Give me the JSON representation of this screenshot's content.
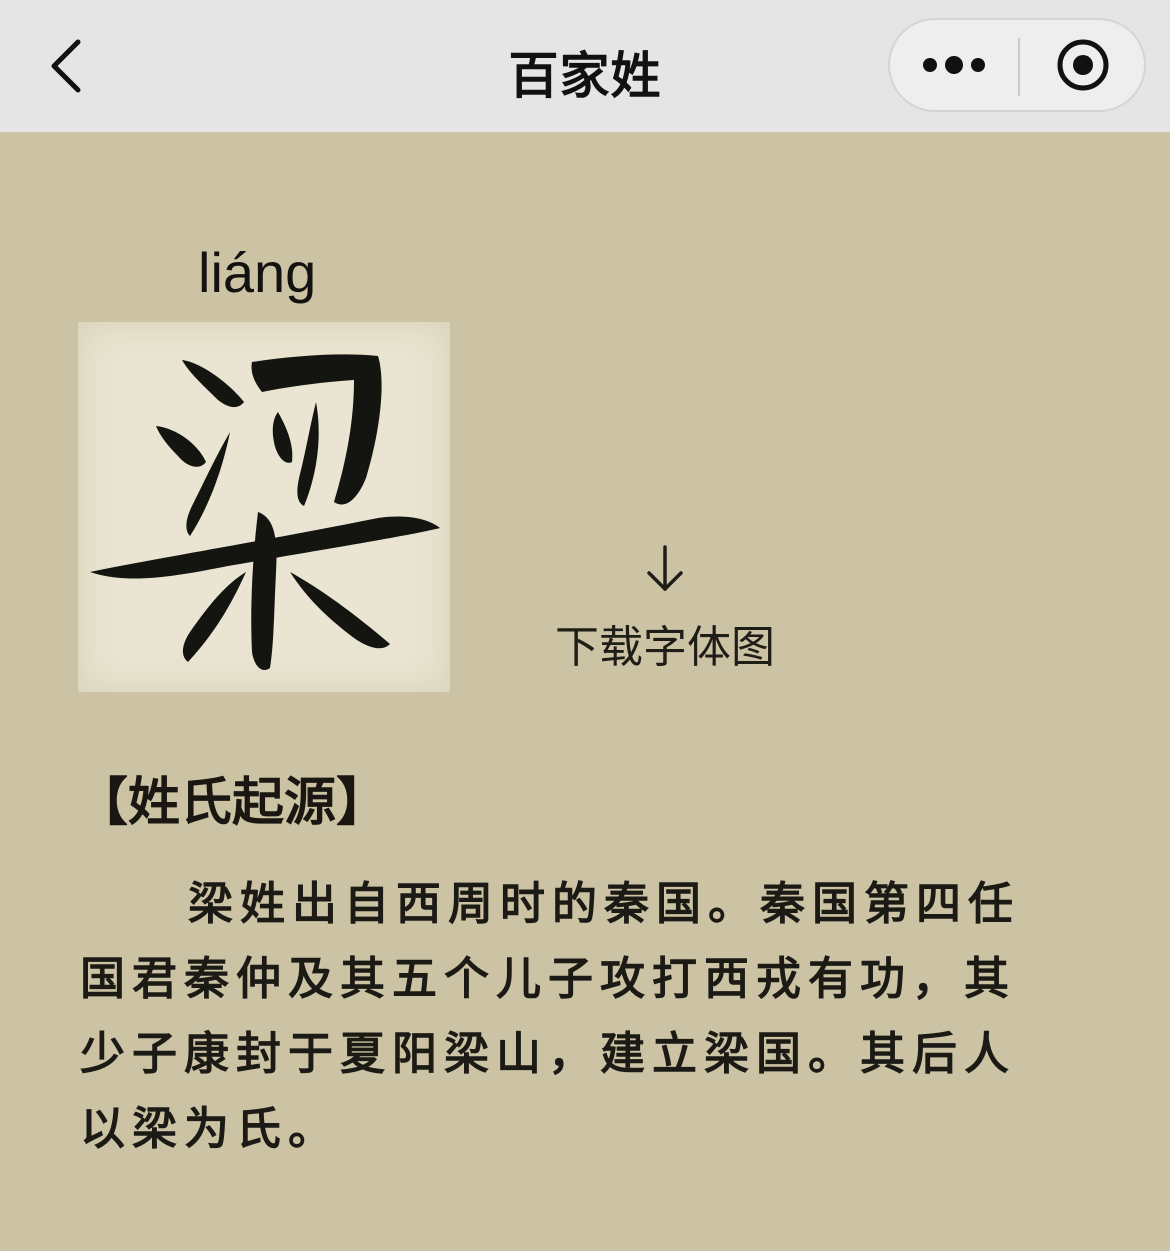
{
  "nav": {
    "title": "百家姓",
    "back_icon": "chevron-left-icon",
    "more_icon": "more-dots-icon",
    "close_icon": "target-close-icon"
  },
  "surname": {
    "pinyin": "liáng",
    "character": "梁"
  },
  "download": {
    "icon": "arrow-down-icon",
    "label": "下载字体图"
  },
  "origin": {
    "title": "【姓氏起源】",
    "text": "梁姓出自西周时的秦国。秦国第四任国君秦仲及其五个儿子攻打西戎有功，其少子康封于夏阳梁山，建立梁国。其后人以梁为氏。"
  },
  "colors": {
    "background": "#cbc3a4",
    "nav_background": "#e5e5e5",
    "card_background": "#e9e5d2",
    "ink": "#1c1a15"
  }
}
